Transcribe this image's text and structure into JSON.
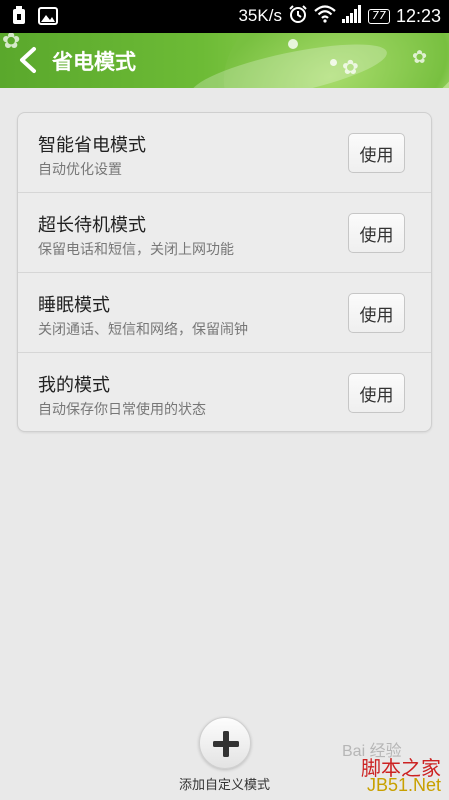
{
  "status_bar": {
    "speed": "35K/s",
    "battery": "77",
    "time": "12:23"
  },
  "header": {
    "title": "省电模式"
  },
  "modes": [
    {
      "title": "智能省电模式",
      "subtitle": "自动优化设置",
      "button": "使用"
    },
    {
      "title": "超长待机模式",
      "subtitle": "保留电话和短信，关闭上网功能",
      "button": "使用"
    },
    {
      "title": "睡眠模式",
      "subtitle": "关闭通话、短信和网络，保留闹钟",
      "button": "使用"
    },
    {
      "title": "我的模式",
      "subtitle": "自动保存你日常使用的状态",
      "button": "使用"
    }
  ],
  "add": {
    "label": "添加自定义模式"
  },
  "watermarks": {
    "baidu": "Bai 经验",
    "site": "脚本之家",
    "domain": "JB51.Net"
  },
  "colors": {
    "header_green": "#6dbb36",
    "background": "#e9e9e9"
  }
}
